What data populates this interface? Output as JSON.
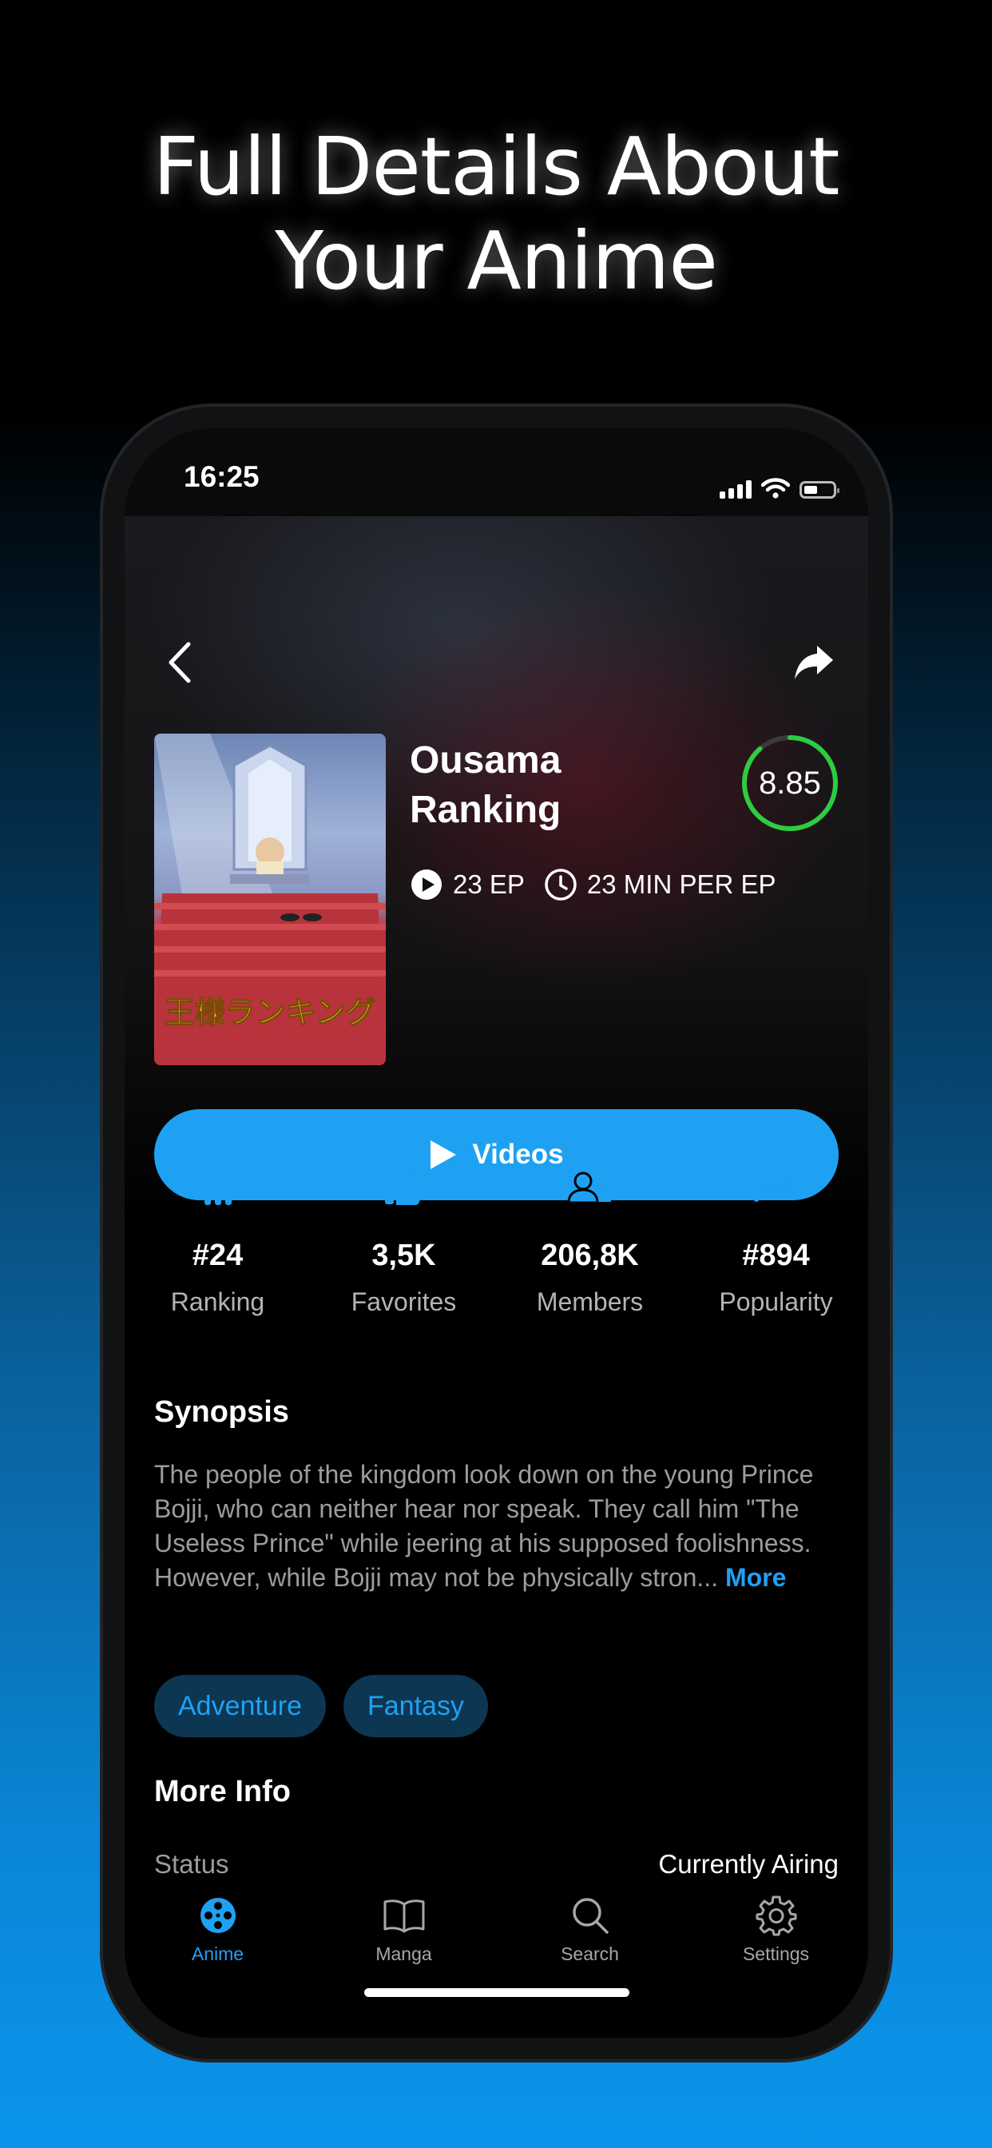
{
  "headline": {
    "line1": "Full Details About",
    "line2": "Your Anime"
  },
  "status_bar": {
    "time": "16:25"
  },
  "anime": {
    "title_line1": "Ousama",
    "title_line2": "Ranking",
    "score": "8.85",
    "score_fraction": 0.885,
    "episodes": "23 EP",
    "duration": "23 MIN PER EP",
    "poster_text": "王様ランキング"
  },
  "videos_button": {
    "label": "Videos"
  },
  "stats": [
    {
      "icon": "bar-chart-icon",
      "value": "#24",
      "label": "Ranking"
    },
    {
      "icon": "thumbs-up-icon",
      "value": "3,5K",
      "label": "Favorites"
    },
    {
      "icon": "users-icon",
      "value": "206,8K",
      "label": "Members"
    },
    {
      "icon": "trending-up-icon",
      "value": "#894",
      "label": "Popularity"
    }
  ],
  "synopsis": {
    "title": "Synopsis",
    "text": "The people of the kingdom look down on the young Prince Bojji, who can neither hear nor speak. They call him \"The Useless Prince\" while jeering at his supposed foolishness. However, while Bojji may not be physically stron...",
    "more_label": "More"
  },
  "genres": [
    "Adventure",
    "Fantasy"
  ],
  "more_info": {
    "title": "More Info",
    "rows": [
      {
        "key": "Status",
        "value": "Currently Airing"
      }
    ]
  },
  "tabs": [
    {
      "label": "Anime",
      "icon": "film-reel-icon",
      "active": true
    },
    {
      "label": "Manga",
      "icon": "book-icon",
      "active": false
    },
    {
      "label": "Search",
      "icon": "search-icon",
      "active": false
    },
    {
      "label": "Settings",
      "icon": "gear-icon",
      "active": false
    }
  ],
  "colors": {
    "accent": "#1ea1f3",
    "score_ring": "#2ecc40",
    "tag_bg": "#0d3652"
  }
}
